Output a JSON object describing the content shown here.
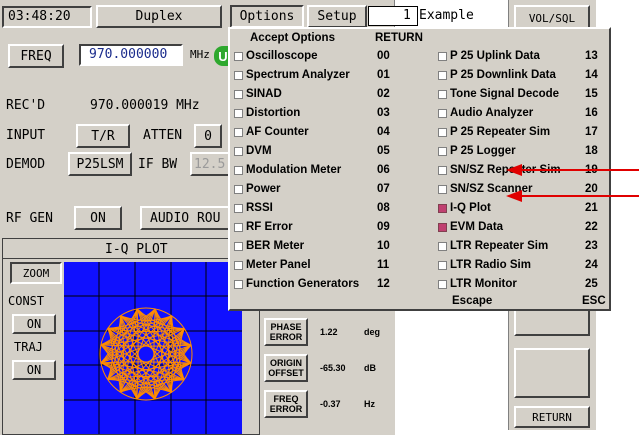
{
  "topbar": {
    "time": "03:48:20",
    "mode": "Duplex",
    "options": "Options",
    "setup": "Setup",
    "example_num": "1",
    "example_label": "Example",
    "volsql": "VOL/SQL"
  },
  "left": {
    "freq_btn": "FREQ",
    "freq_value": "970.000000",
    "freq_unit": "MHz",
    "freq_led": "U",
    "recd_label": "REC'D",
    "recd_value": "970.000019 MHz",
    "input_label": "INPUT",
    "input_value": "T/R",
    "atten_label": "ATTEN",
    "atten_value": "0",
    "demod_label": "DEMOD",
    "demod_value": "P25LSM",
    "ifbw_label": "IF BW",
    "ifbw_value": "12.5",
    "rfgen_label": "RF GEN",
    "rfgen_value": "ON",
    "audio_route": "AUDIO ROU"
  },
  "iq": {
    "title": "I-Q PLOT",
    "zoom": "ZOOM",
    "const_label": "CONST",
    "const_value": "ON",
    "traj_label": "TRAJ",
    "traj_value": "ON"
  },
  "measurements": [
    {
      "label": "PHASE ERROR",
      "value": "1.22",
      "unit": "deg"
    },
    {
      "label": "ORIGIN OFFSET",
      "value": "-65.30",
      "unit": "dB"
    },
    {
      "label": "FREQ ERROR",
      "value": "-0.37",
      "unit": "Hz"
    }
  ],
  "menu": {
    "header_left": "Accept Options",
    "header_return": "RETURN",
    "left_items": [
      {
        "label": "Oscilloscope",
        "code": "00",
        "checked": false
      },
      {
        "label": "Spectrum Analyzer",
        "code": "01",
        "checked": false
      },
      {
        "label": "SINAD",
        "code": "02",
        "checked": false
      },
      {
        "label": "Distortion",
        "code": "03",
        "checked": false
      },
      {
        "label": "AF Counter",
        "code": "04",
        "checked": false
      },
      {
        "label": "DVM",
        "code": "05",
        "checked": false
      },
      {
        "label": "Modulation Meter",
        "code": "06",
        "checked": false
      },
      {
        "label": "Power",
        "code": "07",
        "checked": false
      },
      {
        "label": "RSSI",
        "code": "08",
        "checked": false
      },
      {
        "label": "RF Error",
        "code": "09",
        "checked": false
      },
      {
        "label": "BER Meter",
        "code": "10",
        "checked": false
      },
      {
        "label": "Meter Panel",
        "code": "11",
        "checked": false
      },
      {
        "label": "Function Generators",
        "code": "12",
        "checked": false
      }
    ],
    "right_items": [
      {
        "label": "P 25 Uplink Data",
        "code": "13",
        "checked": false
      },
      {
        "label": "P 25 Downlink Data",
        "code": "14",
        "checked": false
      },
      {
        "label": "Tone Signal Decode",
        "code": "15",
        "checked": false
      },
      {
        "label": "Audio Analyzer",
        "code": "16",
        "checked": false
      },
      {
        "label": "P 25 Repeater Sim",
        "code": "17",
        "checked": false
      },
      {
        "label": "P 25 Logger",
        "code": "18",
        "checked": false
      },
      {
        "label": "SN/SZ Repeater Sim",
        "code": "19",
        "checked": false
      },
      {
        "label": "SN/SZ Scanner",
        "code": "20",
        "checked": false
      },
      {
        "label": "I-Q Plot",
        "code": "21",
        "checked": true
      },
      {
        "label": "EVM Data",
        "code": "22",
        "checked": true
      },
      {
        "label": "LTR Repeater Sim",
        "code": "23",
        "checked": false
      },
      {
        "label": "LTR Radio Sim",
        "code": "24",
        "checked": false
      },
      {
        "label": "LTR Monitor",
        "code": "25",
        "checked": false
      }
    ],
    "escape_label": "Escape",
    "escape_code": "ESC"
  },
  "right_return": "RETURN",
  "colors": {
    "panel": "#d4d0c8",
    "plot_bg": "#1010ff",
    "trace": "#ff8c00",
    "arrow": "#e00000",
    "check_on": "#c04070"
  }
}
